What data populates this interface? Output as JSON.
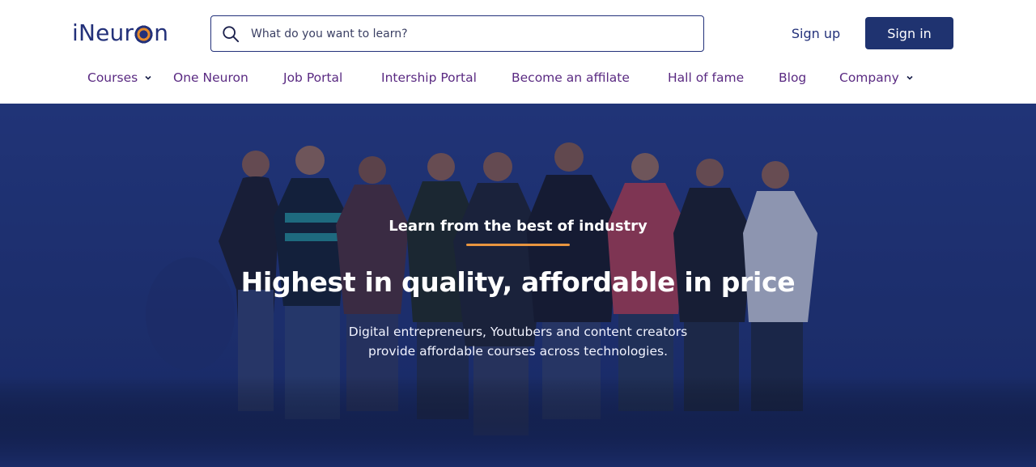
{
  "header": {
    "logo_text_left": "iNeur",
    "logo_text_right": "n",
    "search_placeholder": "What do you want to learn?",
    "signup_label": "Sign up",
    "signin_label": "Sign in"
  },
  "nav": {
    "items": [
      {
        "label": "Courses",
        "dropdown": true
      },
      {
        "label": "One Neuron"
      },
      {
        "label": "Job Portal"
      },
      {
        "label": "Intership Portal"
      },
      {
        "label": "Become an affilate"
      },
      {
        "label": "Hall of fame"
      },
      {
        "label": "Blog"
      },
      {
        "label": "Company",
        "dropdown": true
      }
    ]
  },
  "hero": {
    "eyebrow": "Learn from the best of industry",
    "headline": "Highest in quality, affordable in price",
    "sub_line_1": "Digital entrepreneurs, Youtubers and content creators",
    "sub_line_2": "provide affordable courses across technologies."
  },
  "colors": {
    "brand_blue": "#23317a",
    "nav_purple": "#5a2a82",
    "hero_bg": "#1d2f6e",
    "accent_orange": "#e8953f"
  }
}
